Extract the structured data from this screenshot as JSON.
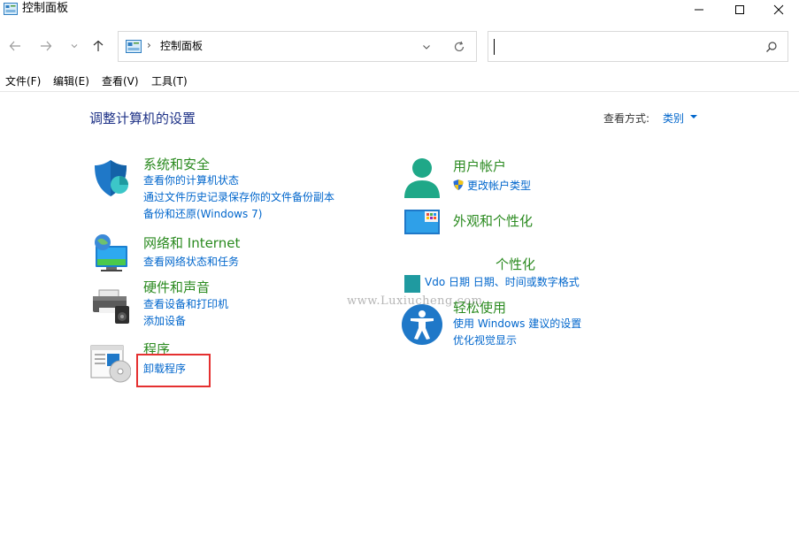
{
  "window": {
    "title": "控制面板"
  },
  "address_bar": {
    "separator": "›",
    "path": "控制面板"
  },
  "search": {
    "value": "",
    "placeholder": ""
  },
  "menu": {
    "items": [
      "文件(F)",
      "编辑(E)",
      "查看(V)",
      "工具(T)"
    ]
  },
  "content": {
    "heading": "调整计算机的设置",
    "view_by_label": "查看方式:",
    "view_by_value": "类别"
  },
  "categories": {
    "system": {
      "title": "系统和安全",
      "links": [
        "查看你的计算机状态",
        "通过文件历史记录保存你的文件备份副本",
        "备份和还原(Windows 7)"
      ]
    },
    "network": {
      "title": "网络和 Internet",
      "links": [
        "查看网络状态和任务"
      ]
    },
    "hardware": {
      "title": "硬件和声音",
      "links": [
        "查看设备和打印机",
        "添加设备"
      ]
    },
    "programs": {
      "title": "程序",
      "links": [
        "卸载程序"
      ]
    },
    "user": {
      "title": "用户帐户",
      "links": [
        "更改帐户类型"
      ]
    },
    "appearance": {
      "title": "外观和个性化",
      "links": []
    },
    "clock": {
      "title": "个性化",
      "links": [
        "Vdo 日期 日期、时间或数字格式"
      ]
    },
    "ease": {
      "title": "轻松使用",
      "links": [
        "使用 Windows 建议的设置",
        "优化视觉显示"
      ]
    }
  },
  "watermark": "www.Luxiucheng.com",
  "colors": {
    "heading": "#1e3287",
    "category_title": "#2a8a1f",
    "link": "#0066cc",
    "highlight": "#e53030"
  }
}
